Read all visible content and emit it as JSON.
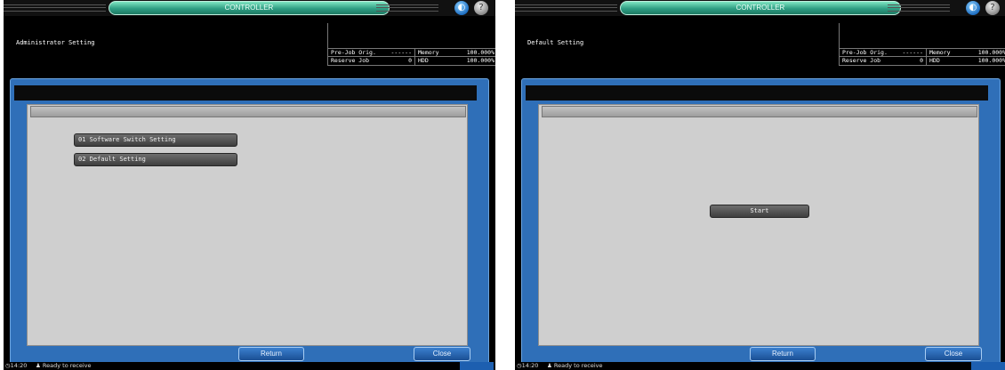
{
  "screens": [
    {
      "capsule_title": "CONTROLLER",
      "header_title": "Administrator Setting",
      "status": {
        "row1": {
          "label": "Pre-Job Orig.",
          "value": "------",
          "label2": "Memory",
          "value2": "100.000%"
        },
        "row2": {
          "label": "Reserve Job",
          "value": "0",
          "label2": "HDD",
          "value2": "100.000%"
        }
      },
      "menu": [
        {
          "label": "01 Software Switch Setting"
        },
        {
          "label": "02 Default Setting"
        }
      ],
      "return_label": "Return",
      "close_label": "Close",
      "footer": {
        "time": "14:20",
        "state": "Ready to receive",
        "badge": ""
      }
    },
    {
      "capsule_title": "CONTROLLER",
      "header_title": "Default Setting",
      "status": {
        "row1": {
          "label": "Pre-Job Orig.",
          "value": "------",
          "label2": "Memory",
          "value2": "100.000%"
        },
        "row2": {
          "label": "Reserve Job",
          "value": "0",
          "label2": "HDD",
          "value2": "100.000%"
        }
      },
      "start_label": "Start",
      "return_label": "Return",
      "close_label": "Close",
      "footer": {
        "time": "14:20",
        "state": "Ready to receive",
        "badge": ""
      }
    }
  ],
  "icons": {
    "globe": "globe-icon",
    "help": "help-icon",
    "clock": "clock-icon",
    "person": "person-icon"
  },
  "colors": {
    "panel_blue": "#2f6fb8",
    "capsule_green": "#2f9e83",
    "button_blue": "#1a4f94"
  }
}
